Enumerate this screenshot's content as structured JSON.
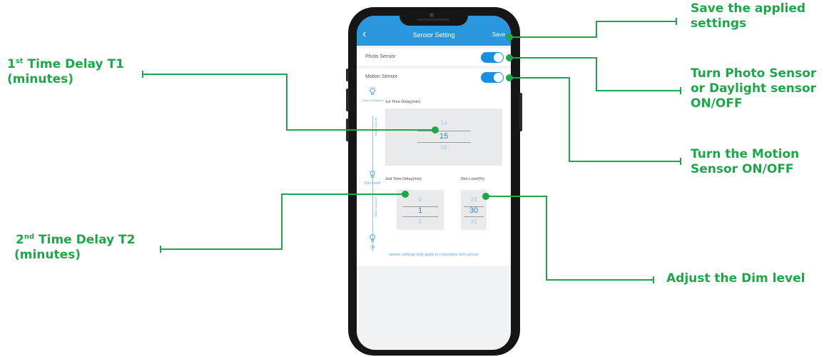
{
  "screen": {
    "title": "Sensor Setting",
    "back_icon": "chevron-left-icon",
    "save_label": "Save",
    "photo_sensor_label": "Photo Sensor",
    "photo_sensor_on": true,
    "motion_sensor_label": "Motion Sensor",
    "motion_sensor_on": true,
    "stages": {
      "motion_detected": "Motion Detected",
      "first_delay": "1st Time Delay",
      "dim_level": "Dim Level",
      "second_delay": "2nd Time Delay",
      "off": "Off"
    },
    "first_delay": {
      "label": "1st Time Delay(min)",
      "prev": "14",
      "value": "15",
      "next": "16"
    },
    "second_delay": {
      "label": "2nd Time Delay(min)",
      "prev": "0",
      "value": "1",
      "next": "2"
    },
    "dim": {
      "label": "Dim Level(%)",
      "prev": "29",
      "value": "30",
      "next": "31"
    },
    "note": "sensor settings only apply to controllers with sensor"
  },
  "annotations": {
    "save": "Save the applied settings",
    "t1_lead": "1",
    "t1_sup": "st",
    "t1_rest": " Time Delay T1",
    "t1_line2": "(minutes)",
    "photo_line1": "Turn Photo Sensor",
    "photo_line2": "or Daylight sensor",
    "photo_line3": "ON/OFF",
    "motion_line1": "Turn the Motion",
    "motion_line2": "Sensor ON/OFF",
    "t2_lead": "2",
    "t2_sup": "nd",
    "t2_rest": " Time Delay T2",
    "t2_line2": "(minutes)",
    "dim": "Adjust the Dim level"
  },
  "colors": {
    "accent": "#1fa64a",
    "appbar": "#2a97dd",
    "toggle": "#1a8fe0"
  }
}
